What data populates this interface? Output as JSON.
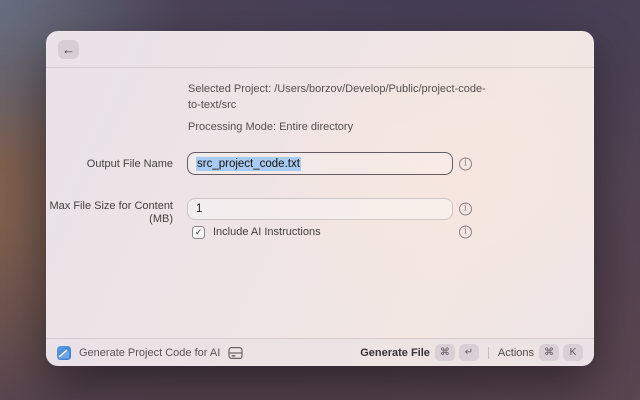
{
  "icons": {
    "back_arrow": "←",
    "info_glyph": "i",
    "checkmark": "✓"
  },
  "meta": {
    "selected_project": "Selected Project: /Users/borzov/Develop/Public/project-code-to-text/src",
    "processing_mode": "Processing Mode: Entire directory"
  },
  "form": {
    "output_file_name": {
      "label": "Output File Name",
      "value": "src_project_code.txt"
    },
    "max_file_size": {
      "label_line1": "Max File Size for Content",
      "label_line2": "(MB)",
      "value": "1"
    },
    "include_ai_instructions": {
      "label": "Include AI Instructions",
      "checked": true
    }
  },
  "footer": {
    "command_name": "Generate Project Code for AI",
    "primary_action": {
      "label": "Generate File",
      "keys": [
        "⌘",
        "↵"
      ]
    },
    "secondary_action": {
      "label": "Actions",
      "keys": [
        "⌘",
        "K"
      ]
    }
  },
  "colors": {
    "selection_highlight": "#a7cbf2",
    "extension_icon_blue": "#3d7ed2",
    "focused_border": "#645e63"
  }
}
